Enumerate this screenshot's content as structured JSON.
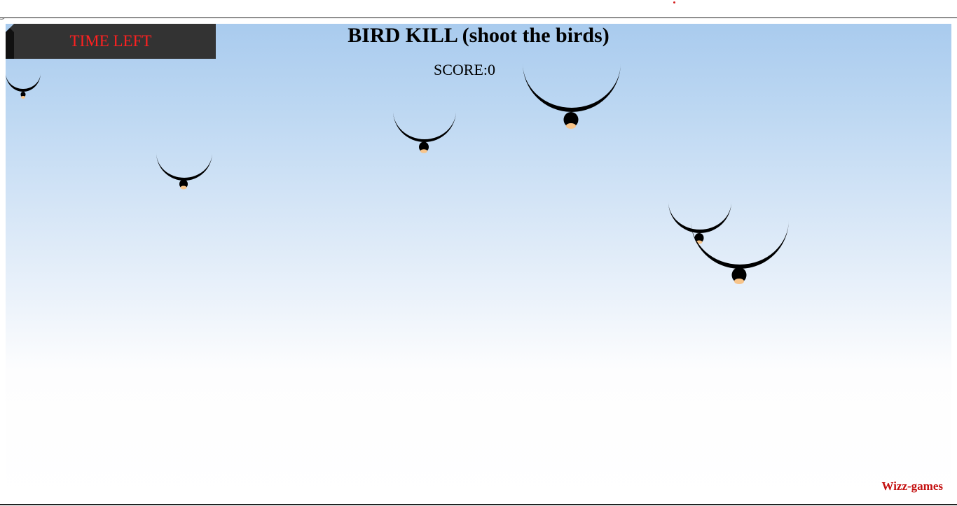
{
  "game": {
    "title": "BIRD KILL (shoot the birds)",
    "score_text": "SCORE:0",
    "timer_label": "TIME LEFT",
    "credit": "Wizz-games"
  },
  "colors": {
    "timer_text": "#ff2020",
    "timer_bg": "#333333",
    "credit_text": "#c41010",
    "sky_top": "#a9cbee",
    "sky_bottom": "#ffffff",
    "bird_body": "#000000",
    "bird_beak": "#f7c48a"
  }
}
